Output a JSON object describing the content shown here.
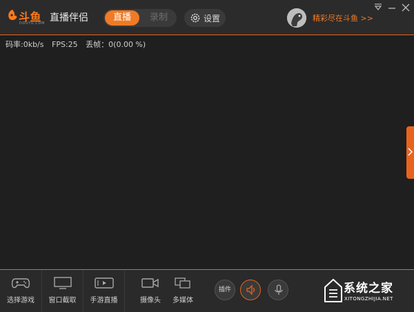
{
  "header": {
    "logo_text": "斗鱼",
    "logo_sub": "DOUYU.COM",
    "app_name": "直播伴侣",
    "mode_live": "直播",
    "mode_record": "录制",
    "settings_label": "设置",
    "promo_text": "精彩尽在斗鱼 >>"
  },
  "stats": {
    "bitrate": "码率:0kb/s",
    "fps": "FPS:25",
    "dropped": "丢帧：0(0.00 %)"
  },
  "toolbar": {
    "select_game": "选择游戏",
    "window_capture": "窗口截取",
    "mobile_live": "手游直播",
    "camera": "摄像头",
    "multimedia": "多媒体",
    "plugin": "插件"
  },
  "watermark": {
    "title": "系统之家",
    "sub": "XITONGZHIJIA.NET"
  },
  "colors": {
    "accent": "#e8641e",
    "brand": "#f07a25",
    "background": "#1f1f1f",
    "panel": "#2a2a2a"
  }
}
